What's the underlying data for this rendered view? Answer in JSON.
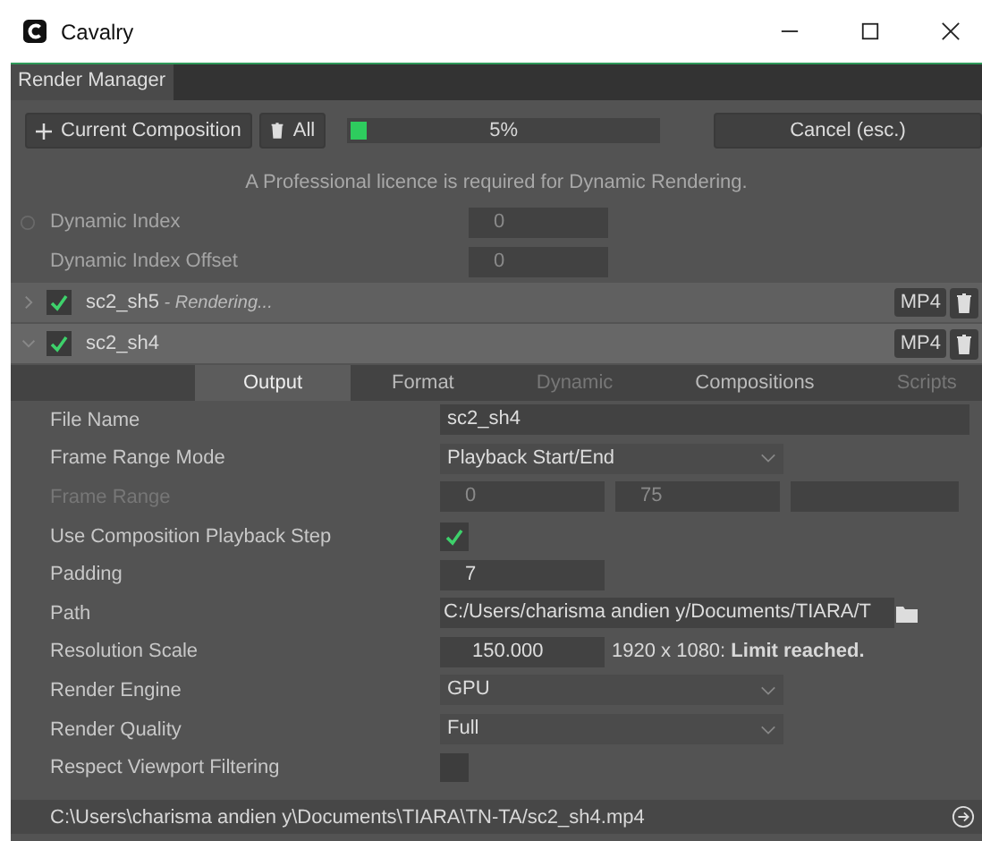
{
  "window": {
    "title": "Cavalry"
  },
  "panel_tabs": [
    {
      "label": "Render Manager",
      "selected": true
    }
  ],
  "toolbar": {
    "add_label": "Current Composition",
    "clear_label": "All",
    "progress": {
      "level": 0.05,
      "text": "5%"
    },
    "cancel_label": "Cancel (esc.)"
  },
  "notice": "A Professional licence is required for Dynamic Rendering.",
  "dynamic_rows": [
    {
      "label": "Dynamic Index",
      "value": "0",
      "radio": true
    },
    {
      "label": "Dynamic Index Offset",
      "value": "0",
      "radio": false
    }
  ],
  "render_items": [
    {
      "name": "sc2_sh5",
      "status": " - Rendering...",
      "checked": true,
      "expanded": false,
      "format": "MP4"
    },
    {
      "name": "sc2_sh4",
      "checked": true,
      "expanded": true,
      "format": "MP4"
    }
  ],
  "tabs": [
    {
      "label": "Output",
      "selected": true,
      "disabled": false
    },
    {
      "label": "Format",
      "selected": false,
      "disabled": false
    },
    {
      "label": "Dynamic",
      "selected": false,
      "disabled": true
    },
    {
      "label": "Compositions",
      "selected": false,
      "disabled": false
    },
    {
      "label": "Scripts",
      "selected": false,
      "disabled": true
    }
  ],
  "properties": [
    {
      "kind": "text",
      "label": "File Name",
      "value": "sc2_sh4",
      "disabled": false
    },
    {
      "kind": "dropdown",
      "label": "Frame Range Mode",
      "value": "Playback Start/End",
      "disabled": false
    },
    {
      "kind": "range",
      "label": "Frame Range",
      "values": [
        "0",
        "75"
      ],
      "disabled": true
    },
    {
      "kind": "checkbox",
      "label": "Use Composition Playback Step",
      "checked": true,
      "disabled": false
    },
    {
      "kind": "number",
      "label": "Padding",
      "value": "7",
      "disabled": false
    },
    {
      "kind": "path",
      "label": "Path",
      "value": "C:/Users/charisma andien y/Documents/TIARA/T",
      "disabled": false
    },
    {
      "kind": "scale",
      "label": "Resolution Scale",
      "value": "150.000",
      "note": "1920 x 1080: **Limit reached.**",
      "disabled": false
    },
    {
      "kind": "dropdown",
      "label": "Render Engine",
      "value": "GPU",
      "disabled": false
    },
    {
      "kind": "dropdown",
      "label": "Render Quality",
      "value": "Full",
      "disabled": false
    },
    {
      "kind": "checkbox",
      "label": "Respect Viewport Filtering",
      "checked": false,
      "disabled": false
    }
  ],
  "output_path": "C:\\Users\\charisma andien y\\Documents\\TIARA\\TN-TA/sc2_sh4.mp4"
}
